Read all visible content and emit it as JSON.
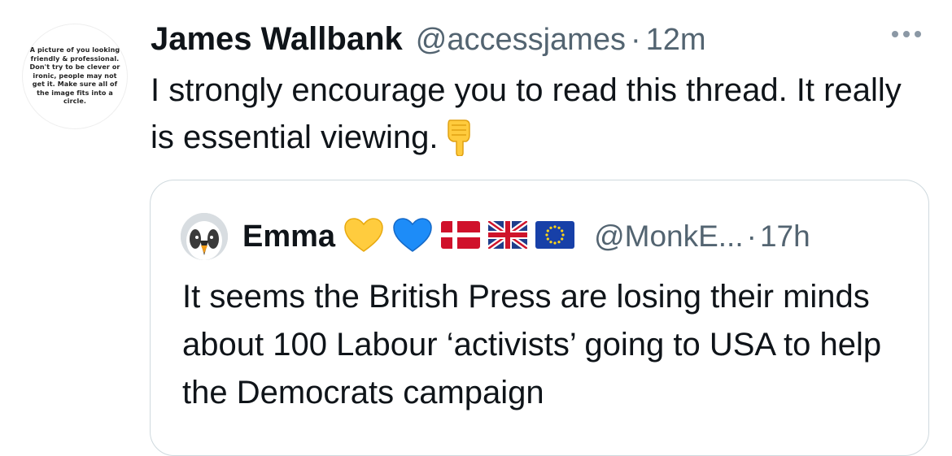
{
  "tweet": {
    "avatar_text": "A picture of you looking friendly & professional. Don't try to be clever or ironic, people may not get it. Make sure all of the image fits into a circle.",
    "display_name": "James Wallbank",
    "handle": "@accessjames",
    "separator": "·",
    "time": "12m",
    "text": "I strongly encourage you to read this thread. It really is essential viewing.",
    "more_icon": "ellipsis-icon",
    "emoji": "backhand-index-pointing-down-icon"
  },
  "quoted": {
    "display_name": "Emma",
    "badges": [
      "yellow-heart-icon",
      "blue-heart-icon",
      "denmark-flag-icon",
      "uk-flag-icon",
      "eu-flag-icon"
    ],
    "handle": "@MonkE...",
    "separator": "·",
    "time": "17h",
    "text": "It seems the British Press are losing their minds about 100 Labour ‘activists’ going to USA to help the Democrats campaign"
  },
  "colors": {
    "text_primary": "#0f1419",
    "text_secondary": "#536471",
    "border": "#cfd9de",
    "heart_yellow": "#ffcc3e",
    "heart_blue": "#1d8cf8"
  }
}
